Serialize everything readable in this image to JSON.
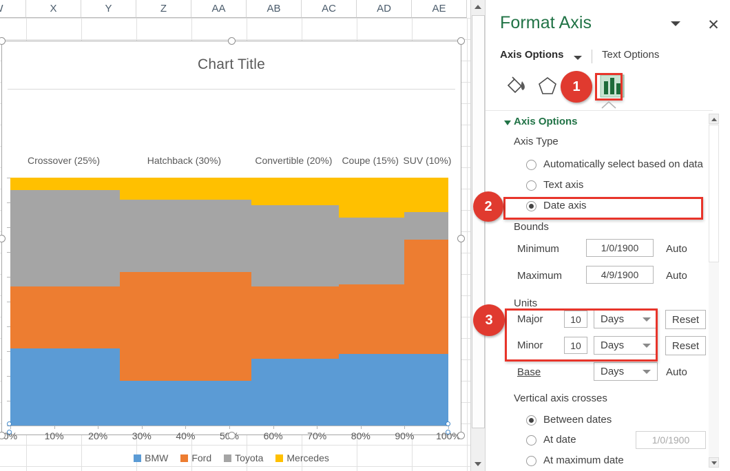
{
  "spreadsheet": {
    "column_headers": [
      "W",
      "X",
      "Y",
      "Z",
      "AA",
      "AB",
      "AC",
      "AD",
      "AE"
    ]
  },
  "chart": {
    "title": "Chart Title",
    "legend": [
      {
        "name": "BMW",
        "color": "#5B9BD5"
      },
      {
        "name": "Ford",
        "color": "#ED7D31"
      },
      {
        "name": "Toyota",
        "color": "#A5A5A5"
      },
      {
        "name": "Mercedes",
        "color": "#FFC000"
      }
    ],
    "x_tick_labels": [
      "0%",
      "10%",
      "20%",
      "30%",
      "40%",
      "50%",
      "60%",
      "70%",
      "80%",
      "90%",
      "100%"
    ],
    "category_labels": [
      "Crossover (25%)",
      "Hatchback (30%)",
      "Convertible (20%)",
      "Coupe (15%)",
      "SUV (10%)"
    ]
  },
  "chart_data": {
    "type": "bar",
    "subtype": "marimekko",
    "title": "Chart Title",
    "xlabel": "",
    "ylabel": "",
    "xlim": [
      0,
      100
    ],
    "ylim": [
      0,
      100
    ],
    "grid": false,
    "legend_position": "bottom",
    "categories": [
      "Crossover",
      "Hatchback",
      "Convertible",
      "Coupe",
      "SUV"
    ],
    "category_labels": [
      "Crossover (25%)",
      "Hatchback (30%)",
      "Convertible (20%)",
      "Coupe (15%)",
      "SUV (10%)"
    ],
    "category_widths_pct": [
      25,
      30,
      20,
      15,
      10
    ],
    "x_tick_labels": [
      "0%",
      "10%",
      "20%",
      "30%",
      "40%",
      "50%",
      "60%",
      "70%",
      "80%",
      "90%",
      "100%"
    ],
    "series": [
      {
        "name": "BMW",
        "color": "#5B9BD5",
        "values": [
          31,
          18,
          27,
          29,
          29
        ]
      },
      {
        "name": "Ford",
        "color": "#ED7D31",
        "values": [
          25,
          44,
          29,
          28,
          46
        ]
      },
      {
        "name": "Toyota",
        "color": "#A5A5A5",
        "values": [
          39,
          29,
          33,
          27,
          11
        ]
      },
      {
        "name": "Mercedes",
        "color": "#FFC000",
        "values": [
          5,
          9,
          11,
          16,
          14
        ]
      }
    ],
    "stack_order_bottom_to_top": [
      "BMW",
      "Ford",
      "Toyota",
      "Mercedes"
    ]
  },
  "pane": {
    "title": "Format Axis",
    "collapse_icon": "chevron-down-icon",
    "close_icon": "close-icon",
    "tabs": {
      "axis_options": "Axis Options",
      "text_options": "Text Options"
    },
    "icons": [
      {
        "name": "fill-and-line-icon"
      },
      {
        "name": "effects-icon"
      },
      {
        "name": "axis-options-chart-icon"
      }
    ],
    "section": {
      "title": "Axis Options",
      "axis_type": {
        "label": "Axis Type",
        "options": [
          {
            "label": "Automatically select based on data",
            "selected": false
          },
          {
            "label": "Text axis",
            "selected": false
          },
          {
            "label": "Date axis",
            "selected": true
          }
        ]
      },
      "bounds": {
        "label": "Bounds",
        "minimum_label": "Minimum",
        "minimum_value": "1/0/1900",
        "minimum_auto": "Auto",
        "maximum_label": "Maximum",
        "maximum_value": "4/9/1900",
        "maximum_auto": "Auto"
      },
      "units": {
        "label": "Units",
        "major_label": "Major",
        "major_value": "10",
        "major_unit": "Days",
        "major_reset": "Reset",
        "minor_label": "Minor",
        "minor_value": "10",
        "minor_unit": "Days",
        "minor_reset": "Reset",
        "base_label": "Base",
        "base_unit": "Days",
        "base_auto": "Auto"
      },
      "vertical_axis_crosses": {
        "label": "Vertical axis crosses",
        "options": [
          {
            "label": "Between dates",
            "selected": true
          },
          {
            "label": "At date",
            "selected": false
          },
          {
            "label": "At maximum date",
            "selected": false
          }
        ],
        "at_date_value": "1/0/1900"
      }
    }
  },
  "annotations": {
    "badges": [
      "1",
      "2",
      "3"
    ],
    "color": "#E03A2F"
  }
}
